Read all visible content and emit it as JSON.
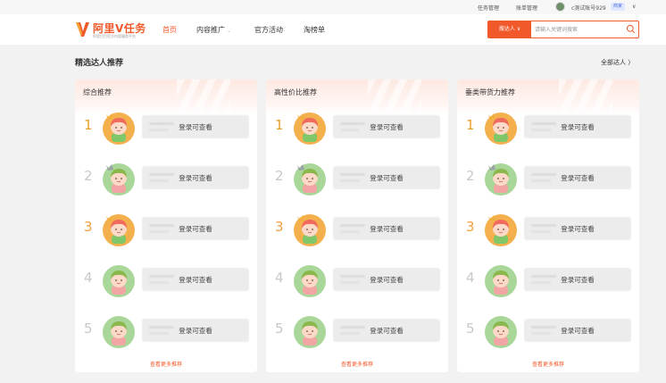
{
  "topbar": {
    "task_manage": "任务管理",
    "bill_manage": "账单管理",
    "username": "c测试账号929",
    "badge": "商家"
  },
  "header": {
    "logo_title": "阿里V任务",
    "logo_sub": "阿里巴巴官方内容服务平台",
    "nav": {
      "home": "首页",
      "content": "内容推广",
      "activity": "官方活动",
      "taobang": "淘榜单"
    },
    "search": {
      "type_label": "搜达人 ∨",
      "placeholder": "请输入关键词搜索"
    }
  },
  "section": {
    "title": "精选达人推荐",
    "all_link": "全部达人 〉"
  },
  "cards": [
    {
      "title": "综合推荐",
      "more": "查看更多推荐",
      "rows": [
        {
          "rank": "1",
          "text": "登录可查看"
        },
        {
          "rank": "2",
          "text": "登录可查看"
        },
        {
          "rank": "3",
          "text": "登录可查看"
        },
        {
          "rank": "4",
          "text": "登录可查看"
        },
        {
          "rank": "5",
          "text": "登录可查看"
        }
      ]
    },
    {
      "title": "高性价比推荐",
      "more": "查看更多推荐",
      "rows": [
        {
          "rank": "1",
          "text": "登录可查看"
        },
        {
          "rank": "2",
          "text": "登录可查看"
        },
        {
          "rank": "3",
          "text": "登录可查看"
        },
        {
          "rank": "4",
          "text": "登录可查看"
        },
        {
          "rank": "5",
          "text": "登录可查看"
        }
      ]
    },
    {
      "title": "垂类带货力推荐",
      "more": "查看更多推荐",
      "rows": [
        {
          "rank": "1",
          "text": "登录可查看"
        },
        {
          "rank": "2",
          "text": "登录可查看"
        },
        {
          "rank": "3",
          "text": "登录可查看"
        },
        {
          "rank": "4",
          "text": "登录可查看"
        },
        {
          "rank": "5",
          "text": "登录可查看"
        }
      ]
    }
  ],
  "colors": {
    "accent": "#f2592a",
    "gold": "#e8a02a",
    "avatar_orange": "#f2b24a",
    "avatar_green": "#9ccf8a"
  }
}
